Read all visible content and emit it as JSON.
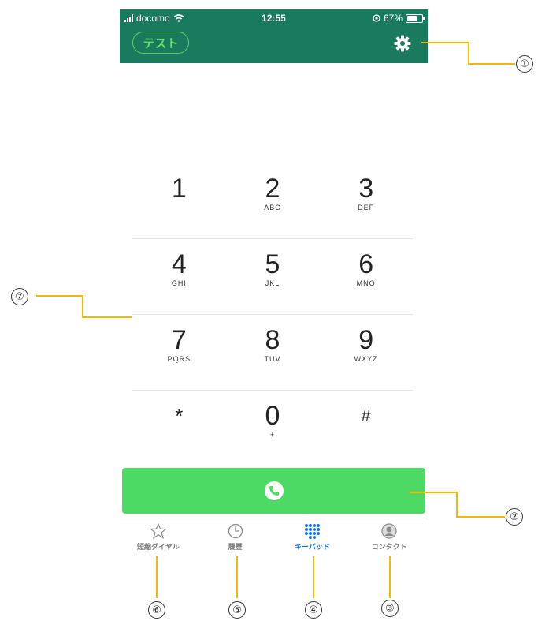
{
  "status": {
    "carrier": "docomo",
    "time": "12:55",
    "battery": "67%",
    "battery_level": 0.67
  },
  "header": {
    "test_label": "テスト",
    "settings_icon": "gear-icon"
  },
  "keypad": {
    "rows": [
      [
        {
          "num": "1",
          "sub": ""
        },
        {
          "num": "2",
          "sub": "ABC"
        },
        {
          "num": "3",
          "sub": "DEF"
        }
      ],
      [
        {
          "num": "4",
          "sub": "GHI"
        },
        {
          "num": "5",
          "sub": "JKL"
        },
        {
          "num": "6",
          "sub": "MNO"
        }
      ],
      [
        {
          "num": "7",
          "sub": "PQRS"
        },
        {
          "num": "8",
          "sub": "TUV"
        },
        {
          "num": "9",
          "sub": "WXYZ"
        }
      ],
      [
        {
          "num": "*",
          "sub": ""
        },
        {
          "num": "0",
          "sub": "+"
        },
        {
          "num": "#",
          "sub": ""
        }
      ]
    ]
  },
  "call": {
    "icon": "phone-icon",
    "color": "#4cd964"
  },
  "tabs": [
    {
      "label": "短縮ダイヤル",
      "icon": "star-icon"
    },
    {
      "label": "履歴",
      "icon": "clock-icon"
    },
    {
      "label": "キーパッド",
      "icon": "keypad-icon",
      "active": true
    },
    {
      "label": "コンタクト",
      "icon": "contact-icon"
    }
  ],
  "callouts": {
    "c1": "①",
    "c2": "②",
    "c3": "③",
    "c4": "④",
    "c5": "⑤",
    "c6": "⑥",
    "c7": "⑦"
  },
  "colors": {
    "header": "#1a7a5e",
    "accent": "#1a73e8",
    "callout_line": "#f5b800"
  }
}
